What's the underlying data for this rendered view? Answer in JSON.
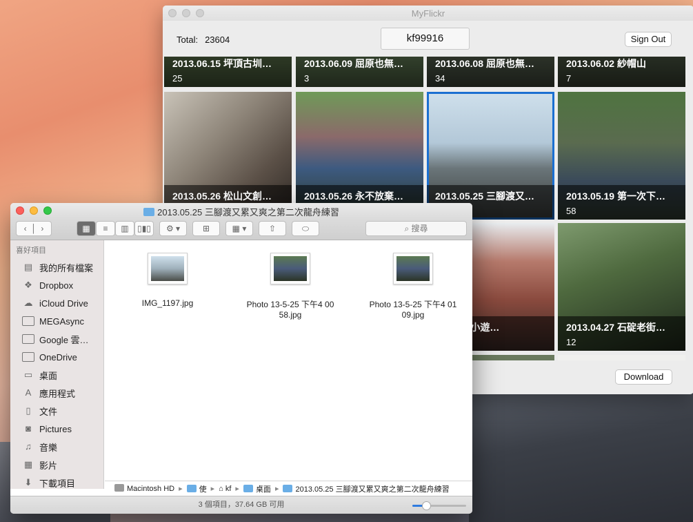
{
  "myflickr": {
    "title": "MyFlickr",
    "total_label": "Total:",
    "total_value": "23604",
    "username": "kf99916",
    "sign_out": "Sign Out",
    "download": "Download",
    "albums": [
      {
        "title": "2013.06.15 坪頂古圳…",
        "count": "25"
      },
      {
        "title": "2013.06.09 屈原也無…",
        "count": "3"
      },
      {
        "title": "2013.06.08 屈原也無…",
        "count": "34"
      },
      {
        "title": "2013.06.02 紗帽山",
        "count": "7"
      },
      {
        "title": "2013.05.26 松山文創…",
        "count": ""
      },
      {
        "title": "2013.05.26 永不放棄…",
        "count": ""
      },
      {
        "title": "2013.05.25 三腳渡又…",
        "count": ""
      },
      {
        "title": "2013.05.19 第一次下…",
        "count": "58"
      },
      {
        "title": ".01 鐵馬小遊…",
        "count": ""
      },
      {
        "title": "2013.04.27 石碇老街…",
        "count": "12"
      }
    ]
  },
  "finder": {
    "title": "2013.05.25 三腳渡又累又爽之第二次龍舟練習",
    "search_placeholder": "搜尋",
    "sidebar_header": "喜好項目",
    "sidebar_items": [
      {
        "icon": "all-files-icon",
        "label": "我的所有檔案"
      },
      {
        "icon": "dropbox-icon",
        "label": "Dropbox"
      },
      {
        "icon": "cloud-icon",
        "label": "iCloud Drive"
      },
      {
        "icon": "folder-icon",
        "label": "MEGAsync"
      },
      {
        "icon": "folder-icon",
        "label": "Google 雲…"
      },
      {
        "icon": "folder-icon",
        "label": "OneDrive"
      },
      {
        "icon": "desktop-icon",
        "label": "桌面"
      },
      {
        "icon": "applications-icon",
        "label": "應用程式"
      },
      {
        "icon": "documents-icon",
        "label": "文件"
      },
      {
        "icon": "camera-icon",
        "label": "Pictures"
      },
      {
        "icon": "music-icon",
        "label": "音樂"
      },
      {
        "icon": "movies-icon",
        "label": "影片"
      },
      {
        "icon": "download-icon",
        "label": "下載項目"
      }
    ],
    "files": [
      {
        "name": "IMG_1197.jpg"
      },
      {
        "name": "Photo 13-5-25 下午4 00 58.jpg"
      },
      {
        "name": "Photo 13-5-25 下午4 01 09.jpg"
      }
    ],
    "path": [
      "Macintosh HD",
      "使",
      "kf",
      "桌面",
      "2013.05.25 三腳渡又累又爽之第二次龍舟練習"
    ],
    "status": "3 個項目，37.64 GB 可用",
    "zoom_level": 0.25
  }
}
